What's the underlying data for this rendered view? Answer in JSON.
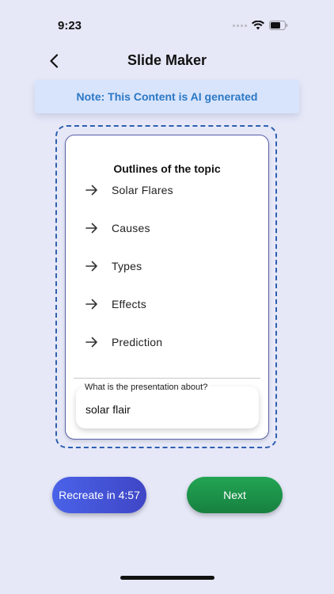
{
  "status_bar": {
    "time": "9:23"
  },
  "header": {
    "title": "Slide Maker"
  },
  "note": {
    "text": "Note: This Content is AI generated"
  },
  "outline": {
    "heading": "Outlines of the topic",
    "items": [
      "Solar Flares",
      "Causes",
      "Types",
      "Effects",
      "Prediction"
    ]
  },
  "topic": {
    "label": "What is the presentation about?",
    "value": "solar flair"
  },
  "actions": {
    "recreate_label": "Recreate in 4:57",
    "next_label": "Next"
  },
  "colors": {
    "background": "#e6e8f8",
    "note_bg": "#d8e4fb",
    "note_text": "#2b78c5",
    "frame": "#2e5fb0",
    "recreate": "#4a62e8",
    "next": "#22a553"
  },
  "icons": {
    "back": "chevron-left-icon",
    "outline_item": "arrow-right-icon",
    "wifi": "wifi-icon",
    "battery": "battery-icon"
  }
}
